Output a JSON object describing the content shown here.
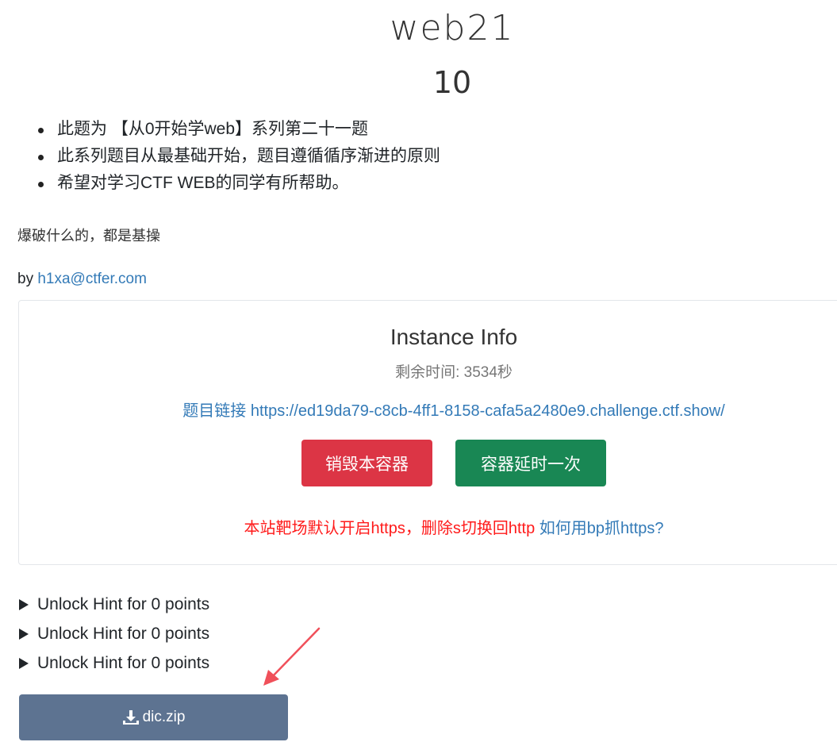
{
  "challenge": {
    "name": "web21",
    "points": "10",
    "description_items": [
      "此题为 【从0开始学web】系列第二十一题",
      "此系列题目从最基础开始，题目遵循循序渐进的原则",
      "希望对学习CTF WEB的同学有所帮助。"
    ],
    "note": "爆破什么的，都是基操",
    "author_prefix": "by ",
    "author_email": "h1xa@ctfer.com"
  },
  "instance": {
    "title": "Instance Info",
    "remaining_time": "剩余时间: 3534秒",
    "link_label": "题目链接",
    "link_url": "https://ed19da79-c8cb-4ff1-8158-cafa5a2480e9.challenge.ctf.show/",
    "destroy_button": "销毁本容器",
    "extend_button": "容器延时一次",
    "notice_red": "本站靶场默认开启https，删除s切换回http",
    "notice_link": "如何用bp抓https?"
  },
  "hints": [
    {
      "label": "Unlock Hint for 0 points"
    },
    {
      "label": "Unlock Hint for 0 points"
    },
    {
      "label": "Unlock Hint for 0 points"
    }
  ],
  "files": {
    "download_label": "dic.zip",
    "download_icon": "download-icon"
  },
  "colors": {
    "danger": "#dc3545",
    "success": "#198754",
    "link": "#337ab7",
    "download_button": "#5d7391",
    "notice_red": "#ff1a1a",
    "annotation_arrow": "#f0505a"
  }
}
